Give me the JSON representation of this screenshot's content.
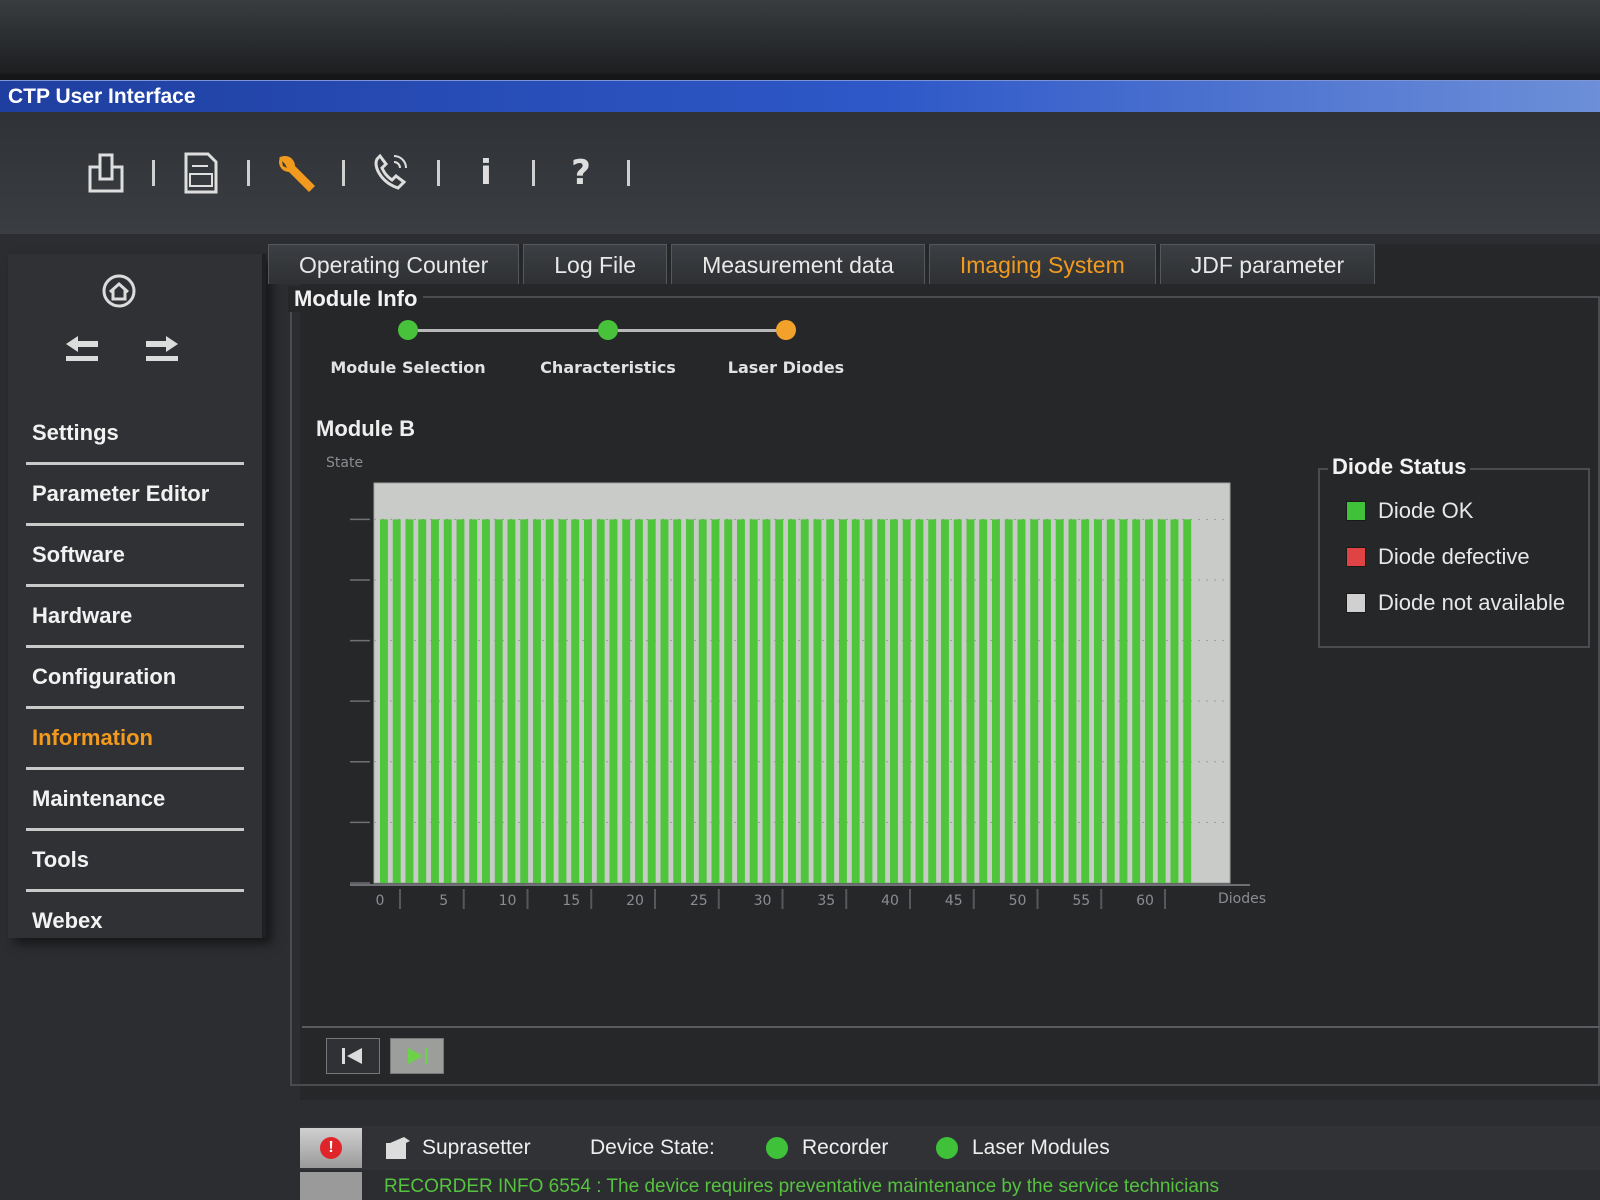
{
  "window": {
    "title": "CTP User Interface"
  },
  "toolbar": {
    "icons": [
      "output-icon",
      "log-document-icon",
      "wrench-icon",
      "remote-support-icon",
      "info-icon",
      "help-icon"
    ],
    "active": "wrench-icon",
    "info_glyph": "i",
    "help_glyph": "?"
  },
  "sidebar": {
    "items": [
      {
        "label": "Settings"
      },
      {
        "label": "Parameter Editor"
      },
      {
        "label": "Software"
      },
      {
        "label": "Hardware"
      },
      {
        "label": "Configuration"
      },
      {
        "label": "Information",
        "active": true
      },
      {
        "label": "Maintenance"
      },
      {
        "label": "Tools"
      },
      {
        "label": "Webex"
      }
    ]
  },
  "tabs": [
    {
      "label": "Operating Counter"
    },
    {
      "label": "Log File"
    },
    {
      "label": "Measurement data"
    },
    {
      "label": "Imaging System",
      "active": true
    },
    {
      "label": "JDF parameter"
    }
  ],
  "module_info": {
    "title": "Module Info",
    "steps": [
      {
        "label": "Module Selection",
        "status": "done"
      },
      {
        "label": "Characteristics",
        "status": "done"
      },
      {
        "label": "Laser Diodes",
        "status": "current"
      }
    ],
    "module_name": "Module B"
  },
  "chart_data": {
    "type": "bar",
    "ylabel": "State",
    "xlabel": "Diodes",
    "x_ticks": [
      "0",
      "5",
      "10",
      "15",
      "20",
      "25",
      "30",
      "35",
      "40",
      "45",
      "50",
      "55",
      "60"
    ],
    "diode_count": 64,
    "values": [
      1,
      1,
      1,
      1,
      1,
      1,
      1,
      1,
      1,
      1,
      1,
      1,
      1,
      1,
      1,
      1,
      1,
      1,
      1,
      1,
      1,
      1,
      1,
      1,
      1,
      1,
      1,
      1,
      1,
      1,
      1,
      1,
      1,
      1,
      1,
      1,
      1,
      1,
      1,
      1,
      1,
      1,
      1,
      1,
      1,
      1,
      1,
      1,
      1,
      1,
      1,
      1,
      1,
      1,
      1,
      1,
      1,
      1,
      1,
      1,
      1,
      1,
      1,
      1
    ],
    "status": "ok",
    "bar_color": "#4fc53c",
    "ylim": [
      0,
      1.1
    ],
    "grid": true
  },
  "diode_status": {
    "title": "Diode Status",
    "items": [
      {
        "label": "Diode OK",
        "color": "#3fc23a"
      },
      {
        "label": "Diode defective",
        "color": "#e04343"
      },
      {
        "label": "Diode not available",
        "color": "#d0d0d0"
      }
    ]
  },
  "status_bar": {
    "device": "Suprasetter",
    "device_state_label": "Device State:",
    "recorder": "Recorder",
    "laser_modules": "Laser Modules",
    "indicator_color": "#3fc23a",
    "message": "RECORDER INFO 6554 : The device requires preventative maintenance by the service technicians"
  }
}
